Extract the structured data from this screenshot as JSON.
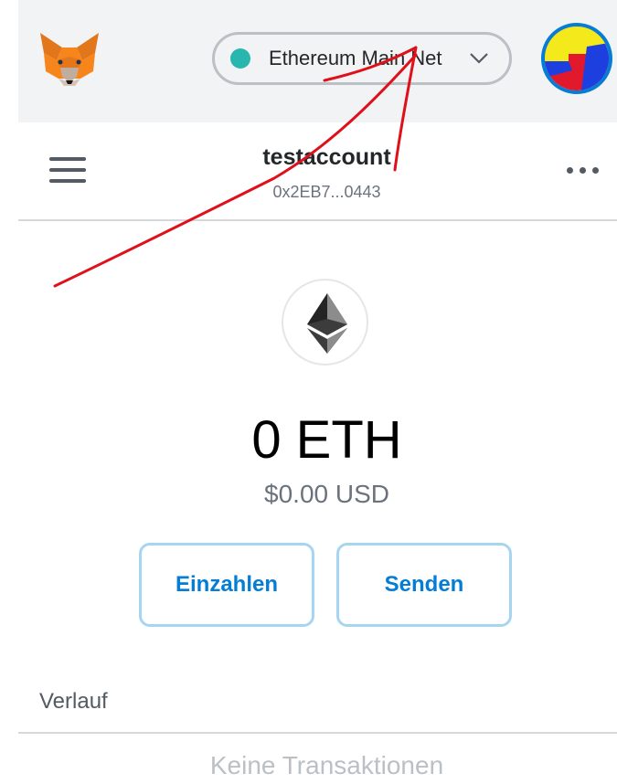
{
  "network": {
    "name": "Ethereum Main Net",
    "status_color": "#29b6af"
  },
  "account": {
    "name": "testaccount",
    "address": "0x2EB7...0443"
  },
  "balance": {
    "primary": "0 ETH",
    "secondary": "$0.00 USD"
  },
  "actions": {
    "deposit_label": "Einzahlen",
    "send_label": "Senden"
  },
  "history": {
    "title": "Verlauf",
    "empty_text": "Keine Transaktionen"
  },
  "icons": {
    "logo": "metamask-fox-icon",
    "network_chevron": "chevron-down-icon",
    "menu": "hamburger-menu-icon",
    "more": "more-options-icon",
    "asset": "ethereum-icon"
  },
  "colors": {
    "accent": "#037dd6",
    "annotation": "#e0101b"
  }
}
